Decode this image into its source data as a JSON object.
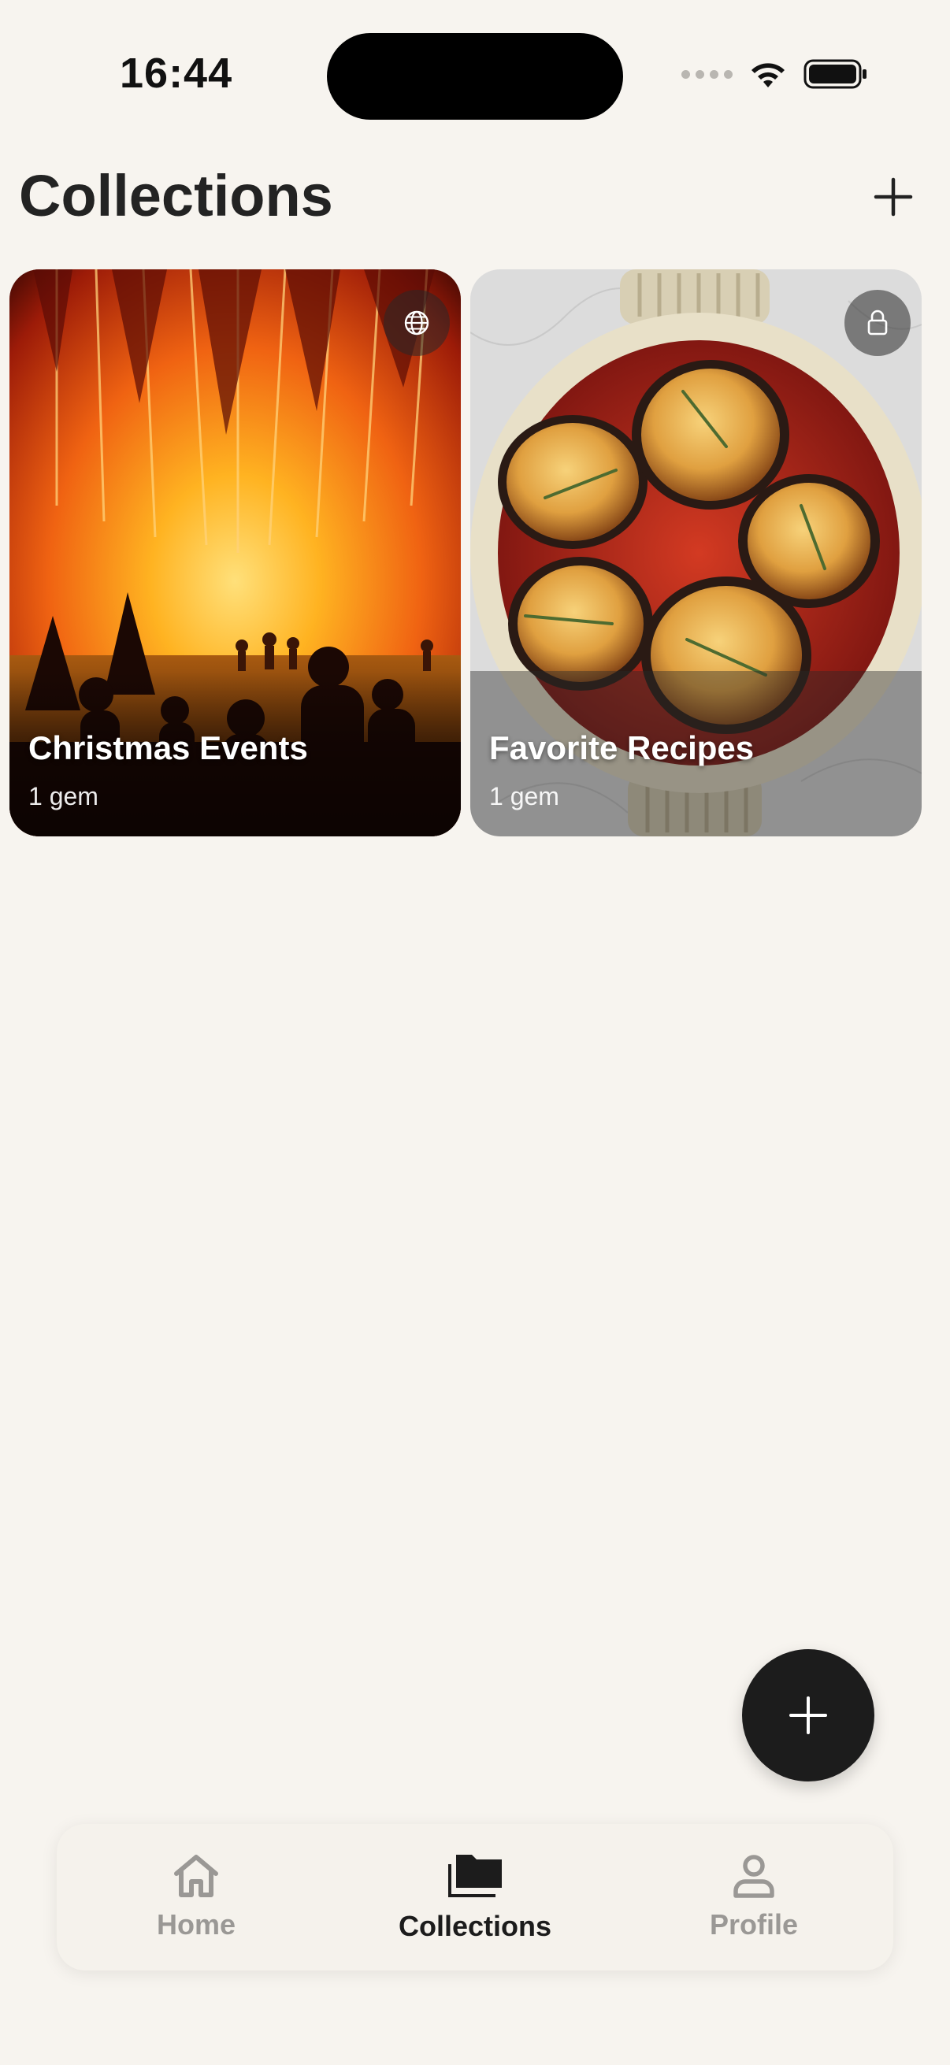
{
  "status_bar": {
    "time": "16:44"
  },
  "header": {
    "title": "Collections"
  },
  "collections": [
    {
      "title": "Christmas Events",
      "count": "1 gem",
      "visibility_icon": "globe-icon"
    },
    {
      "title": "Favorite Recipes",
      "count": "1 gem",
      "visibility_icon": "lock-icon"
    }
  ],
  "tab_bar": {
    "tabs": [
      {
        "label": "Home",
        "icon": "house-icon",
        "active": false
      },
      {
        "label": "Collections",
        "icon": "folder-icon",
        "active": true
      },
      {
        "label": "Profile",
        "icon": "person-icon",
        "active": false
      }
    ]
  },
  "colors": {
    "background": "#f7f4ef",
    "fab": "#1c1c1c",
    "tab_active": "#1c1c1c",
    "tab_inactive": "#9a9895"
  }
}
